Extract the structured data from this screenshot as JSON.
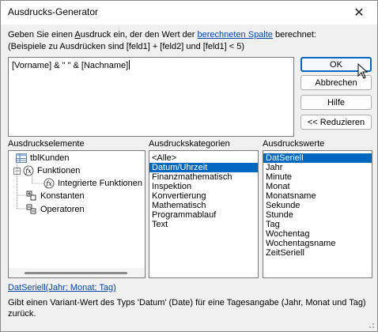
{
  "window": {
    "title": "Ausdrucks-Generator",
    "close_glyph": "✕"
  },
  "instructions": {
    "line1_pre": "Geben Sie einen ",
    "line1_key": "A",
    "line1_mid": "usdruck ein, der den Wert der ",
    "line1_link": "berechneten Spalte",
    "line1_post": " berechnet:",
    "line2": "(Beispiele zu Ausdrücken sind [feld1] + [feld2] und [feld1] < 5)"
  },
  "expression": {
    "value": "[Vorname] & \" \" & [Nachname]"
  },
  "buttons": {
    "ok": "OK",
    "cancel": "Abbrechen",
    "help": "Hilfe",
    "reduce": "<< Reduzieren"
  },
  "elements_panel": {
    "label": "Ausdruckselemente",
    "tree": [
      {
        "label": "tblKunden",
        "icon": "table-icon",
        "expander": ""
      },
      {
        "label": "Funktionen",
        "icon": "function-icon",
        "expander": "−"
      },
      {
        "label": "Integrierte Funktionen",
        "icon": "function-icon",
        "expander": ""
      },
      {
        "label": "Konstanten",
        "icon": "constants-icon",
        "expander": ""
      },
      {
        "label": "Operatoren",
        "icon": "operators-icon",
        "expander": ""
      }
    ]
  },
  "categories_panel": {
    "label": "Ausdruckskategorien",
    "items": [
      "<Alle>",
      "Datum/Uhrzeit",
      "Finanzmathematisch",
      "Inspektion",
      "Konvertierung",
      "Mathematisch",
      "Programmablauf",
      "Text"
    ],
    "selected_index": 1
  },
  "values_panel": {
    "label": "Ausdruckswerte",
    "items": [
      "DatSeriell",
      "Jahr",
      "Minute",
      "Monat",
      "Monatsname",
      "Sekunde",
      "Stunde",
      "Tag",
      "Wochentag",
      "Wochentagsname",
      "ZeitSeriell"
    ],
    "selected_index": 0
  },
  "function_signature": "DatSeriell(Jahr; Monat; Tag)",
  "description": "Gibt einen Variant-Wert des Typs 'Datum' (Date) für eine Tagesangabe (Jahr, Monat und Tag) zurück.",
  "colors": {
    "accent": "#0067c0",
    "link": "#0645ad",
    "dialog_bg": "#f0f0f0"
  }
}
